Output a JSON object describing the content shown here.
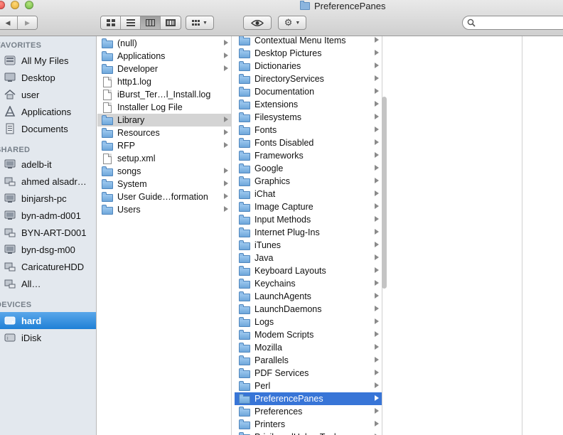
{
  "window": {
    "title": "PreferencePanes"
  },
  "toolbar": {
    "back_glyph": "◀",
    "forward_glyph": "▶",
    "view_modes": [
      "icon-view",
      "list-view",
      "column-view",
      "cover-flow-view"
    ],
    "active_view": "column-view",
    "search_value": ""
  },
  "sidebar": {
    "favorites_label": "FAVORITES",
    "favorites": [
      {
        "label": "All My Files",
        "icon": "all-files-icon"
      },
      {
        "label": "Desktop",
        "icon": "desktop-icon"
      },
      {
        "label": "user",
        "icon": "home-icon"
      },
      {
        "label": "Applications",
        "icon": "applications-icon"
      },
      {
        "label": "Documents",
        "icon": "documents-icon"
      }
    ],
    "shared_label": "SHARED",
    "shared": [
      {
        "label": "adelb-it"
      },
      {
        "label": "ahmed alsadr…"
      },
      {
        "label": "binjarsh-pc"
      },
      {
        "label": "byn-adm-d001"
      },
      {
        "label": "BYN-ART-D001"
      },
      {
        "label": "byn-dsg-m00"
      },
      {
        "label": "CaricatureHDD"
      },
      {
        "label": "All…"
      }
    ],
    "devices_label": "DEVICES",
    "devices": [
      {
        "label": "hard",
        "selected": true
      },
      {
        "label": "iDisk",
        "selected": false
      }
    ]
  },
  "column1": [
    {
      "label": "(null)",
      "kind": "folder",
      "arrow": true
    },
    {
      "label": "Applications",
      "kind": "folder",
      "arrow": true
    },
    {
      "label": "Developer",
      "kind": "folder",
      "arrow": true
    },
    {
      "label": "http1.log",
      "kind": "file",
      "arrow": false
    },
    {
      "label": "iBurst_Ter…l_Install.log",
      "kind": "file",
      "arrow": false
    },
    {
      "label": "Installer Log File",
      "kind": "file",
      "arrow": false
    },
    {
      "label": "Library",
      "kind": "folder",
      "arrow": true,
      "state": "path"
    },
    {
      "label": "Resources",
      "kind": "folder",
      "arrow": true
    },
    {
      "label": "RFP",
      "kind": "folder",
      "arrow": true
    },
    {
      "label": "setup.xml",
      "kind": "file",
      "arrow": false
    },
    {
      "label": "songs",
      "kind": "folder",
      "arrow": true
    },
    {
      "label": "System",
      "kind": "folder",
      "arrow": true
    },
    {
      "label": "User Guide…formation",
      "kind": "folder",
      "arrow": true
    },
    {
      "label": "Users",
      "kind": "folder",
      "arrow": true
    }
  ],
  "column2": [
    {
      "label": "Contextual Menu Items"
    },
    {
      "label": "Desktop Pictures"
    },
    {
      "label": "Dictionaries"
    },
    {
      "label": "DirectoryServices"
    },
    {
      "label": "Documentation"
    },
    {
      "label": "Extensions"
    },
    {
      "label": "Filesystems"
    },
    {
      "label": "Fonts"
    },
    {
      "label": "Fonts Disabled"
    },
    {
      "label": "Frameworks"
    },
    {
      "label": "Google"
    },
    {
      "label": "Graphics"
    },
    {
      "label": "iChat"
    },
    {
      "label": "Image Capture"
    },
    {
      "label": "Input Methods"
    },
    {
      "label": "Internet Plug-Ins"
    },
    {
      "label": "iTunes"
    },
    {
      "label": "Java"
    },
    {
      "label": "Keyboard Layouts"
    },
    {
      "label": "Keychains"
    },
    {
      "label": "LaunchAgents"
    },
    {
      "label": "LaunchDaemons"
    },
    {
      "label": "Logs"
    },
    {
      "label": "Modem Scripts"
    },
    {
      "label": "Mozilla"
    },
    {
      "label": "Parallels"
    },
    {
      "label": "PDF Services"
    },
    {
      "label": "Perl"
    },
    {
      "label": "PreferencePanes",
      "state": "selected"
    },
    {
      "label": "Preferences"
    },
    {
      "label": "Printers"
    },
    {
      "label": "PrivilegedHelperTools"
    }
  ],
  "colors": {
    "selection": "#3875d7",
    "sidebar_selection": "#1f80d6",
    "sidebar_bg": "#e3e8ee",
    "folder": "#6fa7db"
  }
}
